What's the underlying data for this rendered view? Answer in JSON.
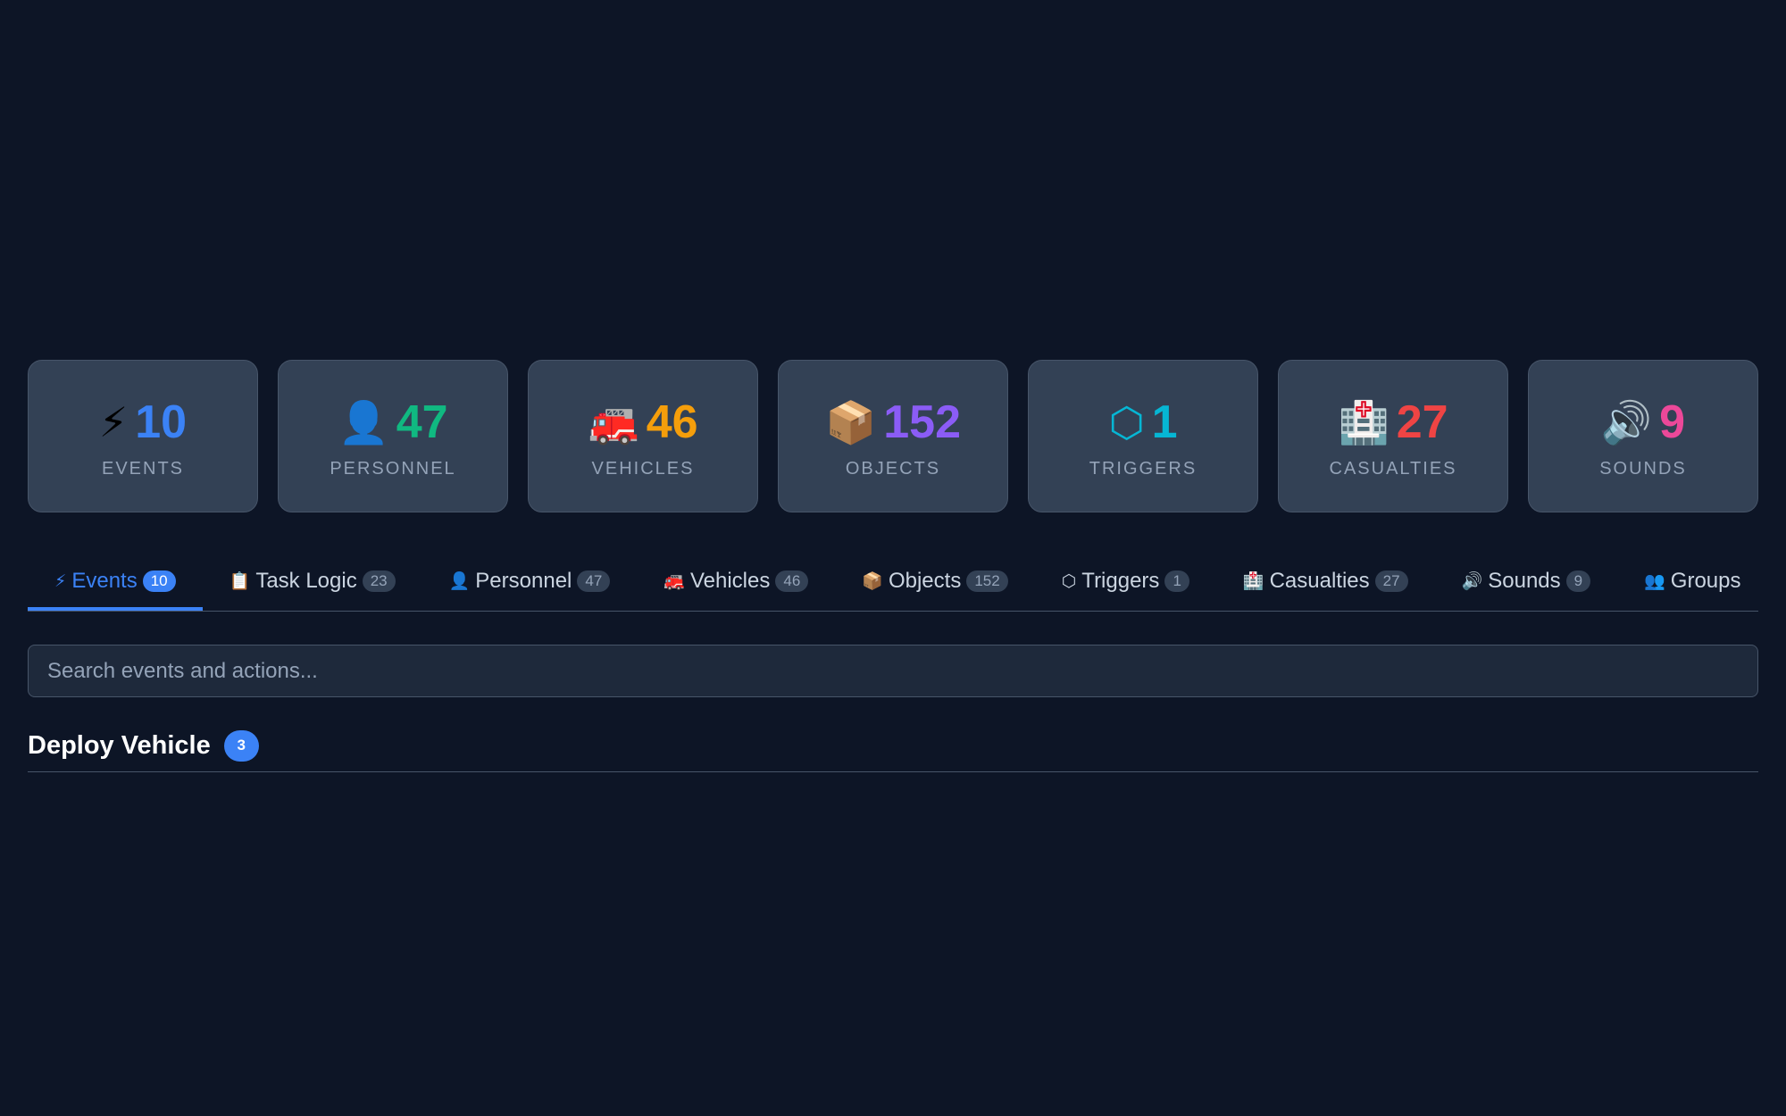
{
  "stats": [
    {
      "icon": "⚡",
      "icon_name": "lightning-icon",
      "value": "10",
      "label": "EVENTS",
      "color": "#3b82f6"
    },
    {
      "icon": "👤",
      "icon_name": "person-icon",
      "value": "47",
      "label": "PERSONNEL",
      "color": "#10b981"
    },
    {
      "icon": "🚒",
      "icon_name": "fire-truck-icon",
      "value": "46",
      "label": "VEHICLES",
      "color": "#f59e0b"
    },
    {
      "icon": "📦",
      "icon_name": "package-icon",
      "value": "152",
      "label": "OBJECTS",
      "color": "#8b5cf6"
    },
    {
      "icon": "⬡",
      "icon_name": "hexagon-icon",
      "value": "1",
      "label": "TRIGGERS",
      "color": "#06b6d4"
    },
    {
      "icon": "🏥",
      "icon_name": "hospital-icon",
      "value": "27",
      "label": "CASUALTIES",
      "color": "#ef4444"
    },
    {
      "icon": "🔊",
      "icon_name": "speaker-icon",
      "value": "9",
      "label": "SOUNDS",
      "color": "#ec4899"
    }
  ],
  "tabs": [
    {
      "icon": "⚡",
      "icon_name": "lightning-icon",
      "label": "Events",
      "count": "10",
      "active": true
    },
    {
      "icon": "📋",
      "icon_name": "clipboard-icon",
      "label": "Task Logic",
      "count": "23"
    },
    {
      "icon": "👤",
      "icon_name": "person-icon",
      "label": "Personnel",
      "count": "47"
    },
    {
      "icon": "🚒",
      "icon_name": "fire-truck-icon",
      "label": "Vehicles",
      "count": "46"
    },
    {
      "icon": "📦",
      "icon_name": "package-icon",
      "label": "Objects",
      "count": "152"
    },
    {
      "icon": "⬡",
      "icon_name": "hexagon-icon",
      "label": "Triggers",
      "count": "1"
    },
    {
      "icon": "🏥",
      "icon_name": "hospital-icon",
      "label": "Casualties",
      "count": "27"
    },
    {
      "icon": "🔊",
      "icon_name": "speaker-icon",
      "label": "Sounds",
      "count": "9"
    },
    {
      "icon": "👥",
      "icon_name": "group-icon",
      "label": "Groups",
      "count": ""
    }
  ],
  "search": {
    "placeholder": "Search events and actions...",
    "value": ""
  },
  "section": {
    "title": "Deploy Vehicle",
    "count": "3"
  },
  "colors": {
    "background": "#0d1526",
    "card": "#334155",
    "accent": "#3b82f6"
  }
}
